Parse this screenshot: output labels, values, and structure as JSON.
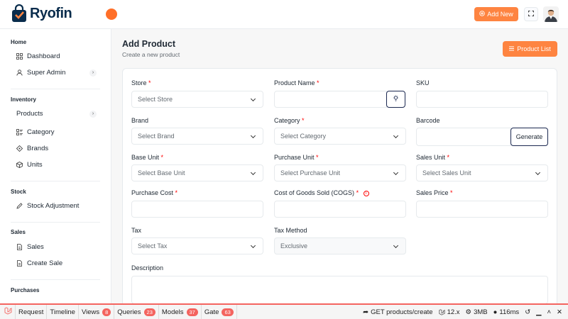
{
  "header": {
    "logo_text": "Ryofin",
    "add_new_label": "Add New",
    "brand_color": "#fe8441"
  },
  "sidebar": {
    "sections": [
      {
        "title": "Home",
        "items": [
          {
            "label": "Dashboard",
            "icon": "grid-icon"
          },
          {
            "label": "Super Admin",
            "icon": "user-icon",
            "expandable": true
          }
        ]
      },
      {
        "title": "Inventory",
        "items": [
          {
            "label": "Products",
            "expandable": true
          },
          {
            "label": "Category",
            "icon": "list-icon"
          },
          {
            "label": "Brands",
            "icon": "tag-icon"
          },
          {
            "label": "Units",
            "icon": "box-icon"
          }
        ]
      },
      {
        "title": "Stock",
        "items": [
          {
            "label": "Stock Adjustment",
            "icon": "edit-icon"
          }
        ]
      },
      {
        "title": "Sales",
        "items": [
          {
            "label": "Sales",
            "icon": "file-icon"
          },
          {
            "label": "Create Sale",
            "icon": "file-icon"
          }
        ]
      },
      {
        "title": "Purchases",
        "items": []
      }
    ]
  },
  "main": {
    "title": "Add Product",
    "subtitle": "Create a new product",
    "product_list_label": "Product List",
    "fields": {
      "store": {
        "label": "Store",
        "placeholder": "Select Store"
      },
      "product_name": {
        "label": "Product Name",
        "value": ""
      },
      "sku": {
        "label": "SKU",
        "value": ""
      },
      "brand": {
        "label": "Brand",
        "placeholder": "Select Brand"
      },
      "category": {
        "label": "Category",
        "placeholder": "Select Category"
      },
      "barcode": {
        "label": "Barcode",
        "value": "",
        "generate_label": "Generate"
      },
      "base_unit": {
        "label": "Base Unit",
        "placeholder": "Select Base Unit"
      },
      "purchase_unit": {
        "label": "Purchase Unit",
        "placeholder": "Select Purchase Unit"
      },
      "sales_unit": {
        "label": "Sales Unit",
        "placeholder": "Select Sales Unit"
      },
      "purchase_cost": {
        "label": "Purchase Cost",
        "value": ""
      },
      "cogs": {
        "label": "Cost of Goods Sold (COGS)",
        "value": ""
      },
      "sales_price": {
        "label": "Sales Price",
        "value": ""
      },
      "tax": {
        "label": "Tax",
        "placeholder": "Select Tax"
      },
      "tax_method": {
        "label": "Tax Method",
        "value": "Exclusive"
      },
      "description": {
        "label": "Description",
        "value": ""
      }
    },
    "required_mark": "*"
  },
  "debugbar": {
    "tabs": [
      {
        "label": "Request"
      },
      {
        "label": "Timeline"
      },
      {
        "label": "Views",
        "count": "8"
      },
      {
        "label": "Queries",
        "count": "23"
      },
      {
        "label": "Models",
        "count": "37"
      },
      {
        "label": "Gate",
        "count": "63"
      }
    ],
    "route": "GET products/create",
    "version": "12.x",
    "memory": "3MB",
    "time": "116ms",
    "accent_color": "#f4645f"
  }
}
